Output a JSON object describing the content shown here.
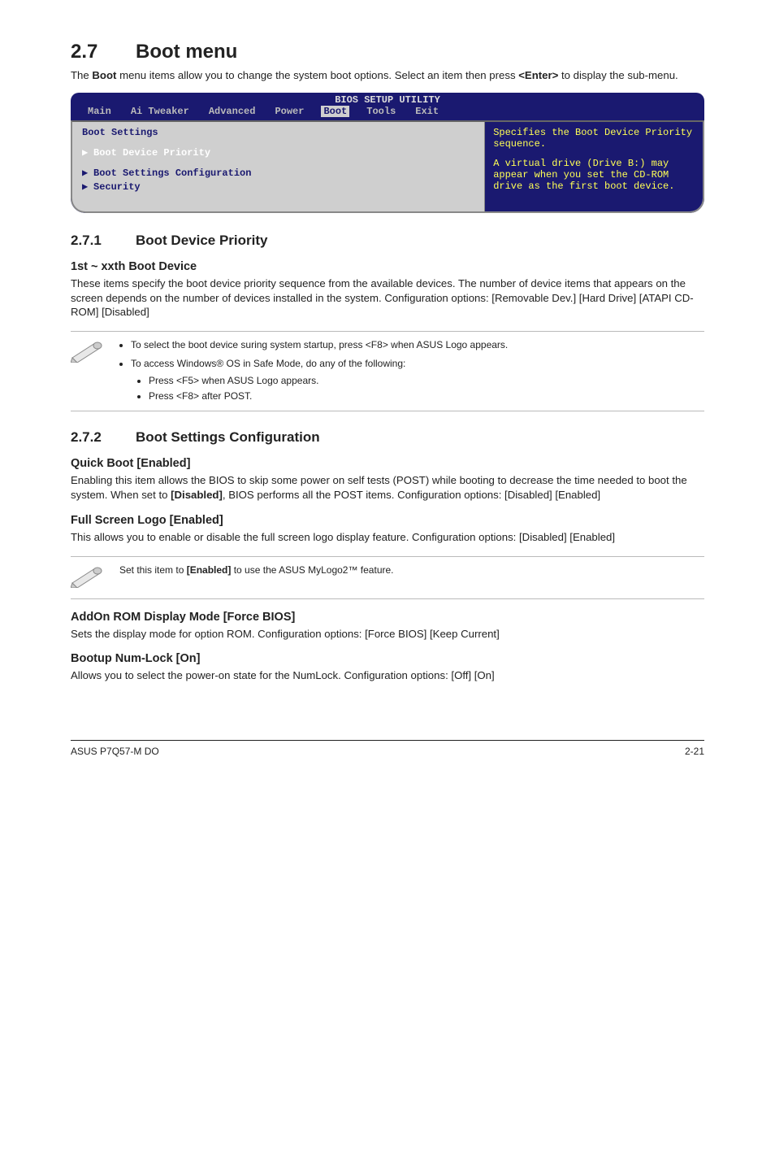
{
  "section": {
    "number": "2.7",
    "title": "Boot menu"
  },
  "intro": {
    "part1": "The ",
    "bold1": "Boot",
    "part2": " menu items allow you to change the system boot options. Select an item then press ",
    "bold2": "<Enter>",
    "part3": " to display the sub-menu."
  },
  "bios": {
    "title": "BIOS SETUP UTILITY",
    "tabs": [
      "Main",
      "Ai Tweaker",
      "Advanced",
      "Power",
      "Boot",
      "Tools",
      "Exit"
    ],
    "active_tab": "Boot",
    "left_heading": "Boot Settings",
    "rows": [
      {
        "label": "Boot Device Priority",
        "selected": true
      },
      {
        "label": "Boot Settings Configuration",
        "selected": false
      },
      {
        "label": "Security",
        "selected": false
      }
    ],
    "help_top": "Specifies the Boot Device Priority sequence.",
    "help_bottom": "A virtual drive (Drive B:) may appear when you set the CD-ROM drive as the first boot device."
  },
  "s271": {
    "number": "2.7.1",
    "title": "Boot Device Priority",
    "h": "1st ~ xxth Boot Device",
    "p": "These items specify the boot device priority sequence from the available devices. The number of device items that appears on the screen depends on the number of devices installed in the system. Configuration options: [Removable Dev.] [Hard Drive] [ATAPI CD-ROM] [Disabled]",
    "note1": "To select the boot device suring system startup, press <F8> when ASUS Logo appears.",
    "note2": "To access Windows® OS in Safe Mode, do any of the following:",
    "note2a": "Press <F5> when ASUS Logo appears.",
    "note2b": "Press <F8> after POST."
  },
  "s272": {
    "number": "2.7.2",
    "title": "Boot Settings Configuration",
    "qb_h": "Quick Boot [Enabled]",
    "qb_p1": "Enabling this item allows the BIOS to skip some power on self tests (POST) while booting to decrease the time needed to boot the system. When set to ",
    "qb_bold": "[Disabled]",
    "qb_p2": ", BIOS performs all the POST items. Configuration options: [Disabled] [Enabled]",
    "fs_h": "Full Screen Logo [Enabled]",
    "fs_p": "This allows you to enable or disable the full screen logo display feature. Configuration options: [Disabled] [Enabled]",
    "note_p1": "Set this item to ",
    "note_bold": "[Enabled]",
    "note_p2": " to use the ASUS MyLogo2™ feature.",
    "addon_h": "AddOn ROM Display Mode [Force BIOS]",
    "addon_p": "Sets the display mode for option ROM. Configuration options: [Force BIOS] [Keep Current]",
    "num_h": "Bootup Num-Lock [On]",
    "num_p": "Allows you to select the power-on state for the NumLock. Configuration options: [Off] [On]"
  },
  "footer": {
    "left": "ASUS P7Q57-M DO",
    "right": "2-21"
  }
}
